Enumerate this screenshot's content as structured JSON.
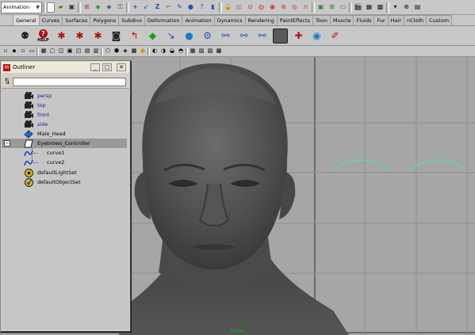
{
  "status_line": {
    "menu_set": "Animation",
    "icons": [
      "new-scene-icon",
      "open-scene-icon",
      "save-scene-icon",
      "select-hierarchy-icon",
      "select-object-icon",
      "select-component-icon",
      "lock-icon",
      "select-handles-icon",
      "select-joints-icon",
      "select-curves-icon",
      "select-surfaces-icon",
      "select-deformations-icon",
      "select-dynamics-icon",
      "select-rendering-icon",
      "select-misc-icon",
      "snap-grid-icon",
      "snap-curve-icon",
      "snap-point-icon",
      "snap-view-plane-icon",
      "make-live-icon",
      "history-icon",
      "render-frame-icon",
      "ipr-render-icon",
      "render-settings-icon",
      "hypershade-icon",
      "attribute-editor-icon",
      "tool-settings-icon",
      "channel-box-icon"
    ]
  },
  "shelf_tabs": [
    "General",
    "Curves",
    "Surfaces",
    "Polygons",
    "Subdivs",
    "Deformation",
    "Animation",
    "Dynamics",
    "Rendering",
    "PaintEffects",
    "Toon",
    "Muscle",
    "Fluids",
    "Fur",
    "Hair",
    "nCloth",
    "Custom"
  ],
  "active_shelf_tab": "General",
  "shelf": {
    "help_label": "HELP",
    "icons": [
      "script-editor-icon",
      "help-icon",
      "render-icon",
      "ipr-icon",
      "render-globals-icon",
      "camera-icon",
      "curve-tool-icon",
      "layer-icon",
      "sphere-icon",
      "joint-tool-icon",
      "ik-handle-icon",
      "skin-icon",
      "blend-shape-icon",
      "graph-editor-icon",
      "dope-sheet-icon",
      "paint-icon",
      "brush-icon"
    ]
  },
  "outliner": {
    "title": "Outliner",
    "search_placeholder": "",
    "items": [
      {
        "label": "persp",
        "type": "camera"
      },
      {
        "label": "top",
        "type": "camera"
      },
      {
        "label": "front",
        "type": "camera"
      },
      {
        "label": "side",
        "type": "camera"
      },
      {
        "label": "Male_Head",
        "type": "mesh"
      },
      {
        "label": "Eyebrows_Controller",
        "type": "group",
        "expanded": true,
        "selected": true
      },
      {
        "label": "curve1",
        "type": "curve",
        "child": true
      },
      {
        "label": "curve2",
        "type": "curve",
        "child": true
      },
      {
        "label": "defaultLightSet",
        "type": "set"
      },
      {
        "label": "defaultObjectSet",
        "type": "set"
      }
    ]
  },
  "viewport": {
    "camera_label": "front",
    "background": "#a6a6a6",
    "curve_color": "#5fd3b8"
  }
}
